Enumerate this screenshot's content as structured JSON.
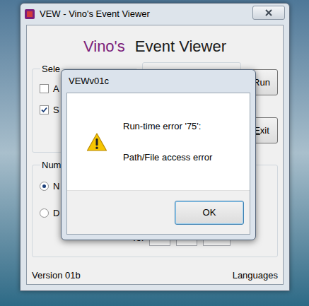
{
  "window": {
    "title": "VEW - Vino's Event Viewer"
  },
  "heading": {
    "brand": "Vino's",
    "title": "Event Viewer"
  },
  "select_group": {
    "label": "Sele",
    "options": [
      {
        "label": "A",
        "checked": false
      },
      {
        "label": "S",
        "checked": true
      }
    ]
  },
  "buttons": [
    {
      "label": "Run"
    },
    {
      "label": "Exit",
      "access_key": "E"
    }
  ],
  "number_group": {
    "label": "Num",
    "options": [
      {
        "label": "N",
        "selected": true
      },
      {
        "label": "D",
        "selected": false
      }
    ],
    "to_label": "To:",
    "fields": [
      "",
      "",
      ""
    ]
  },
  "status_bar": {
    "version": "Version 01b",
    "languages": "Languages"
  },
  "dialog": {
    "title": "VEWv01c",
    "message": [
      "Run-time error '75':",
      "Path/File access error"
    ],
    "buttons": [
      {
        "label": "OK",
        "default": true
      }
    ]
  }
}
